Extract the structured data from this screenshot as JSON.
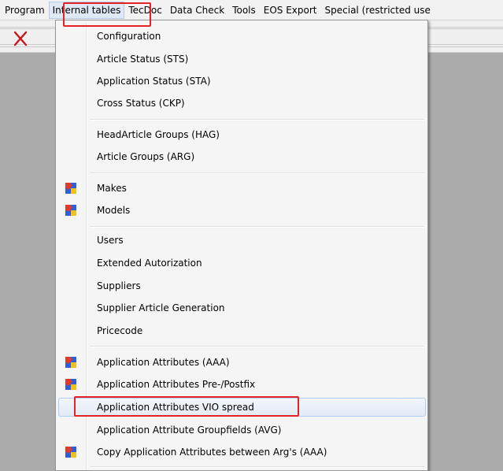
{
  "menubar": {
    "items": [
      "Program",
      "Internal tables",
      "TecDoc",
      "Data Check",
      "Tools",
      "EOS Export",
      "Special (restricted use"
    ]
  },
  "toolbar": {
    "close_icon": "close-icon"
  },
  "menu": {
    "items": [
      {
        "label": "Configuration",
        "icon": null
      },
      {
        "label": "Article Status (STS)",
        "icon": null
      },
      {
        "label": "Application Status (STA)",
        "icon": null
      },
      {
        "label": "Cross Status (CKP)",
        "icon": null
      },
      {
        "label": "HeadArticle Groups (HAG)",
        "icon": null
      },
      {
        "label": "Article Groups (ARG)",
        "icon": null
      },
      {
        "label": "Makes",
        "icon": "puzzle-icon"
      },
      {
        "label": "Models",
        "icon": "puzzle-icon"
      },
      {
        "label": "Users",
        "icon": null
      },
      {
        "label": "Extended Autorization",
        "icon": null
      },
      {
        "label": "Suppliers",
        "icon": null
      },
      {
        "label": "Supplier Article Generation",
        "icon": null
      },
      {
        "label": "Pricecode",
        "icon": null
      },
      {
        "label": "Application Attributes (AAA)",
        "icon": "puzzle-icon"
      },
      {
        "label": "Application Attributes Pre-/Postfix",
        "icon": "puzzle-icon"
      },
      {
        "label": "Application Attributes VIO spread",
        "icon": null
      },
      {
        "label": "Application Attribute Groupfields (AVG)",
        "icon": null
      },
      {
        "label": "Copy Application Attributes between Arg's (AAA)",
        "icon": "puzzle-icon"
      }
    ]
  },
  "colors": {
    "highlight_red": "#e42228",
    "hover_border": "#aecff7"
  }
}
